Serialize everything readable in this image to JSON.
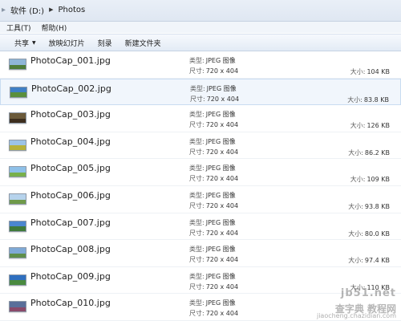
{
  "breadcrumb": {
    "prefix": "▸",
    "items": [
      "软件 (D:)",
      "Photos"
    ]
  },
  "menubar": {
    "items": [
      "工具(T)",
      "帮助(H)"
    ]
  },
  "toolbar": {
    "share_label": "共享",
    "slideshow_label": "放映幻灯片",
    "burn_label": "刻录",
    "new_folder_label": "新建文件夹"
  },
  "labels": {
    "type": "类型:",
    "dims": "尺寸:",
    "size": "大小:"
  },
  "files": [
    {
      "name": "PhotoCap_001.jpg",
      "type": "JPEG 图像",
      "dims": "720 x 404",
      "size": "104 KB"
    },
    {
      "name": "PhotoCap_002.jpg",
      "type": "JPEG 图像",
      "dims": "720 x 404",
      "size": "83.8 KB"
    },
    {
      "name": "PhotoCap_003.jpg",
      "type": "JPEG 图像",
      "dims": "720 x 404",
      "size": "126 KB"
    },
    {
      "name": "PhotoCap_004.jpg",
      "type": "JPEG 图像",
      "dims": "720 x 404",
      "size": "86.2 KB"
    },
    {
      "name": "PhotoCap_005.jpg",
      "type": "JPEG 图像",
      "dims": "720 x 404",
      "size": "109 KB"
    },
    {
      "name": "PhotoCap_006.jpg",
      "type": "JPEG 图像",
      "dims": "720 x 404",
      "size": "93.8 KB"
    },
    {
      "name": "PhotoCap_007.jpg",
      "type": "JPEG 图像",
      "dims": "720 x 404",
      "size": "80.0 KB"
    },
    {
      "name": "PhotoCap_008.jpg",
      "type": "JPEG 图像",
      "dims": "720 x 404",
      "size": "97.4 KB"
    },
    {
      "name": "PhotoCap_009.jpg",
      "type": "JPEG 图像",
      "dims": "720 x 404",
      "size": "110 KB"
    },
    {
      "name": "PhotoCap_010.jpg",
      "type": "JPEG 图像",
      "dims": "720 x 404",
      "size": ""
    }
  ],
  "thumb_colors": [
    {
      "sky": "#8fb6d8",
      "land": "#4f7d3a"
    },
    {
      "sky": "#3f7fc4",
      "land": "#5b8f3d"
    },
    {
      "sky": "#6b5a3a",
      "land": "#3d2e1e"
    },
    {
      "sky": "#9cc3e6",
      "land": "#b7b23a"
    },
    {
      "sky": "#8ec0e8",
      "land": "#78b04a"
    },
    {
      "sky": "#b6d3ec",
      "land": "#6f9a4a"
    },
    {
      "sky": "#4b86cf",
      "land": "#3f7a3a"
    },
    {
      "sky": "#7fa9d6",
      "land": "#5f8f4a"
    },
    {
      "sky": "#2f6fbf",
      "land": "#4a8a3f"
    },
    {
      "sky": "#5a6f9a",
      "land": "#8a4a6a"
    }
  ],
  "watermark": {
    "line1": "jb51.net",
    "line2": "查字典 教程网",
    "line3": "jiaocheng.chazidian.com"
  }
}
